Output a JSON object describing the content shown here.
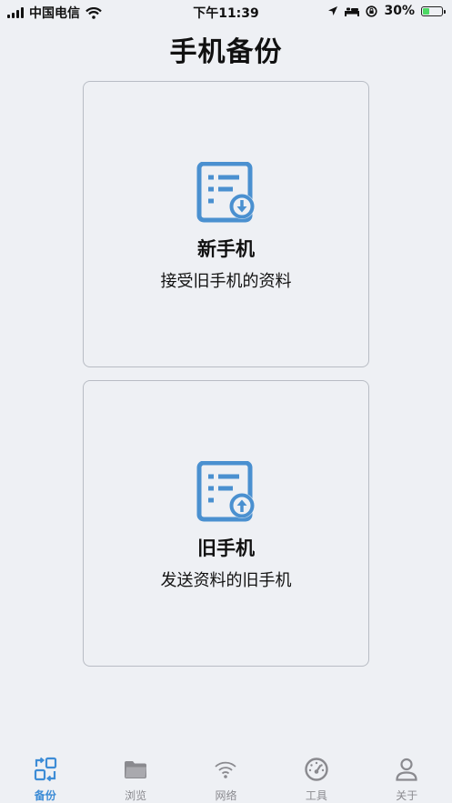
{
  "status_bar": {
    "carrier": "中国电信",
    "time": "下午11:39",
    "battery_percent": "30%",
    "battery_level": 0.3,
    "icons": [
      "signal-icon",
      "wifi-icon",
      "location-arrow-icon",
      "bed-icon",
      "rotation-lock-icon",
      "battery-charging-icon"
    ]
  },
  "page": {
    "title": "手机备份"
  },
  "cards": [
    {
      "title": "新手机",
      "subtitle": "接受旧手机的资料",
      "icon": "document-download-icon"
    },
    {
      "title": "旧手机",
      "subtitle": "发送资料的旧手机",
      "icon": "document-upload-icon"
    }
  ],
  "tabs": [
    {
      "label": "备份",
      "icon": "backup-icon",
      "active": true
    },
    {
      "label": "浏览",
      "icon": "folder-icon",
      "active": false
    },
    {
      "label": "网络",
      "icon": "wifi-icon",
      "active": false
    },
    {
      "label": "工具",
      "icon": "speedometer-icon",
      "active": false
    },
    {
      "label": "关于",
      "icon": "person-icon",
      "active": false
    }
  ],
  "colors": {
    "accent": "#3d8cd6",
    "icon_blue": "#4a90d0",
    "tab_inactive": "#8a8a8f",
    "background": "#eef0f4",
    "card_border": "#b8bcc4"
  }
}
